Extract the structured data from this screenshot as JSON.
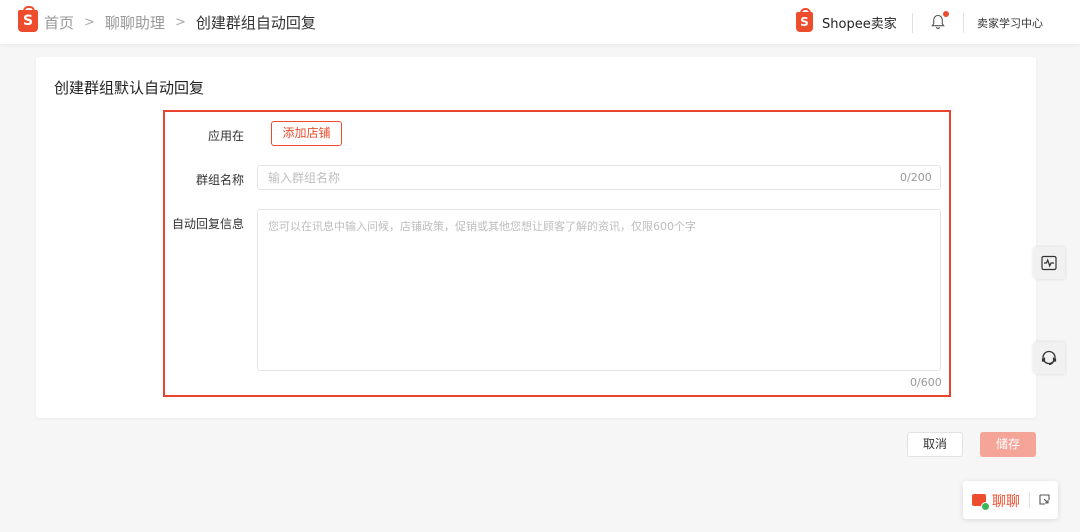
{
  "topbar": {
    "breadcrumbs": [
      "首页",
      "聊聊助理"
    ],
    "current": "创建群组自动回复",
    "brand": "Shopee卖家",
    "learning_center": "卖家学习中心"
  },
  "card": {
    "title": "创建群组默认自动回复",
    "apply_label": "应用在",
    "add_shop_button": "添加店铺",
    "group_name_label": "群组名称",
    "group_name_placeholder": "输入群组名称",
    "group_name_value": "",
    "group_name_counter": "0/200",
    "reply_label": "自动回复信息",
    "reply_placeholder": "您可以在讯息中输入问候，店铺政策，促销或其他您想让顾客了解的资讯，仅限600个字",
    "reply_value": "",
    "reply_counter": "0/600"
  },
  "actions": {
    "cancel": "取消",
    "save": "储存"
  },
  "chat": {
    "label": "聊聊"
  },
  "colors": {
    "accent": "#ee4d2d",
    "highlight_frame": "#e8432f",
    "save_disabled": "#f4a597"
  },
  "icons": [
    "shopee-logo-icon",
    "chevron-right-icon",
    "bell-icon",
    "activity-monitor-icon",
    "headset-icon",
    "chat-bubble-icon",
    "expand-icon"
  ]
}
